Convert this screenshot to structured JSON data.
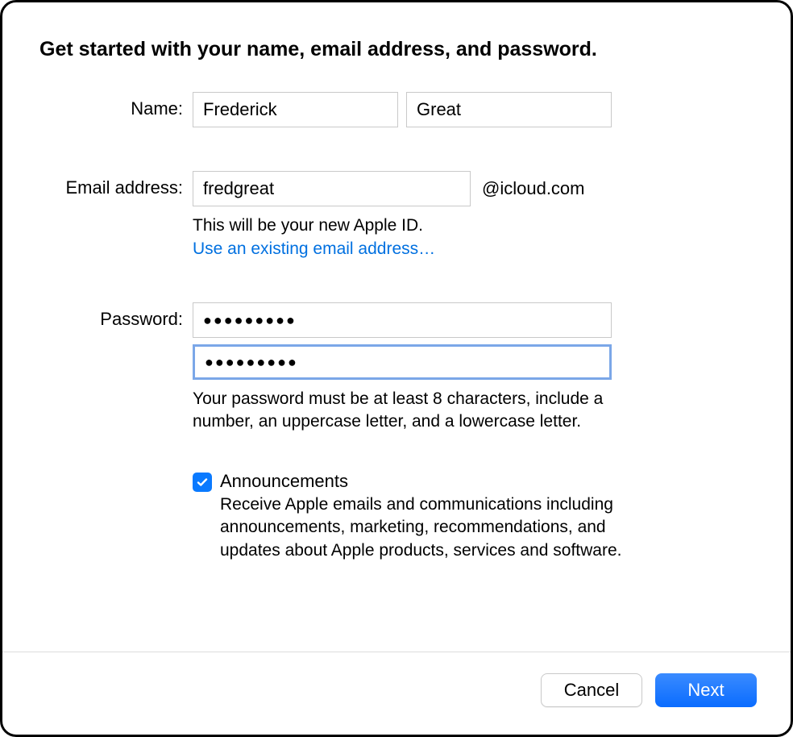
{
  "heading": "Get started with your name, email address, and password.",
  "name": {
    "label": "Name:",
    "first_value": "Frederick",
    "last_value": "Great"
  },
  "email": {
    "label": "Email address:",
    "prefix_value": "fredgreat",
    "suffix": "@icloud.com",
    "helper": "This will be your new Apple ID.",
    "link": "Use an existing email address…"
  },
  "password": {
    "label": "Password:",
    "value": "●●●●●●●●●",
    "confirm_value": "●●●●●●●●●",
    "helper": "Your password must be at least 8 characters, include a number, an uppercase letter, and a lowercase letter."
  },
  "announcements": {
    "checked": true,
    "title": "Announcements",
    "desc": "Receive Apple emails and communications including announcements, marketing, recommendations, and updates about Apple products, services and software."
  },
  "footer": {
    "cancel": "Cancel",
    "next": "Next"
  }
}
